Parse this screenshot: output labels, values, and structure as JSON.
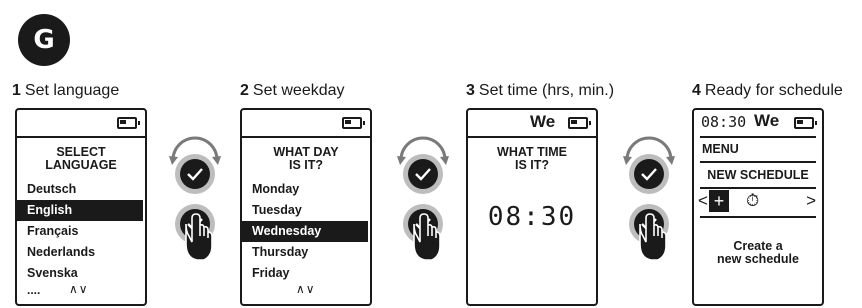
{
  "badge": "G",
  "steps": [
    {
      "num": "1",
      "title": "Set language",
      "heading": "SELECT\nLANGUAGE",
      "items": [
        "Deutsch",
        "English",
        "Français",
        "Nederlands",
        "Svenska"
      ],
      "selected_index": 1,
      "footer_dots": "....",
      "footer_arrows": "∧∨"
    },
    {
      "num": "2",
      "title": "Set weekday",
      "heading": "WHAT DAY\nIS IT?",
      "items": [
        "Monday",
        "Tuesday",
        "Wednesday",
        "Thursday",
        "Friday"
      ],
      "selected_index": 2,
      "footer_arrows": "∧∨"
    },
    {
      "num": "3",
      "title": "Set time (hrs, min.)",
      "top_day": "We",
      "heading": "WHAT TIME\nIS IT?",
      "time": "08:30"
    },
    {
      "num": "4",
      "title": "Ready for schedule",
      "top_time": "08:30",
      "top_day": "We",
      "menu": "MENU",
      "new_schedule": "NEW SCHEDULE",
      "toolbar": {
        "left": "<",
        "plus": "+",
        "timer": "⏱",
        "right": ">"
      },
      "caption": "Create a\nnew schedule"
    }
  ],
  "colors": {
    "ink": "#1a1a1a",
    "knob_inner": "#1a1a1a",
    "knob_ring": "#bdbdbd",
    "rotate_arrow": "#7a7a7a"
  }
}
